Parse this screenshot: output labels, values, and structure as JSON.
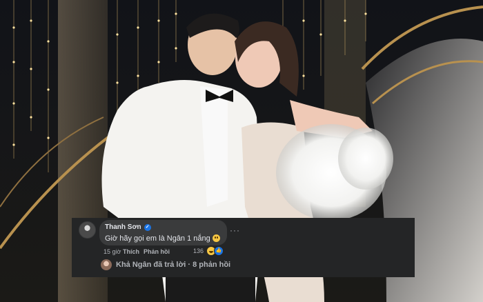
{
  "comment": {
    "author": "Thanh Sơn",
    "verified_icon": "verified-badge-icon",
    "text": "Giờ hãy gọi em là Ngân 1 nắng",
    "text_emoji": "grimacing-emoji-icon",
    "more_label": "···",
    "time": "15 giờ",
    "like_label": "Thích",
    "reply_label": "Phản hồi",
    "reaction_count": "136",
    "reactions": [
      "haha-reaction-icon",
      "like-reaction-icon"
    ]
  },
  "reply_summary": {
    "text": "Khả Ngân đã trả lời · 8 phản hồi"
  },
  "colors": {
    "panel_bg": "#242526",
    "bubble_bg": "#3a3b3c",
    "text_primary": "#e4e6eb",
    "text_secondary": "#b0b3b8",
    "accent_blue": "#1b74e4"
  }
}
